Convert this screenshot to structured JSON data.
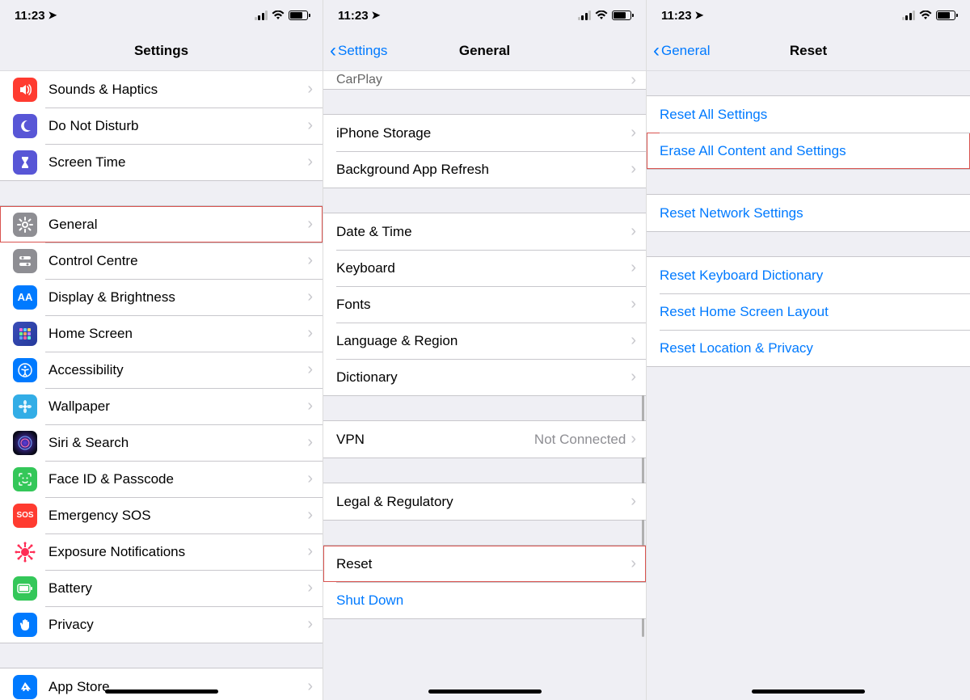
{
  "status": {
    "time": "11:23"
  },
  "screen1": {
    "title": "Settings",
    "groups": [
      [
        {
          "id": "sounds",
          "label": "Sounds & Haptics",
          "icon": "sounds-icon",
          "bg": "bg-red"
        },
        {
          "id": "dnd",
          "label": "Do Not Disturb",
          "icon": "moon-icon",
          "bg": "bg-purple"
        },
        {
          "id": "screentime",
          "label": "Screen Time",
          "icon": "hourglass-icon",
          "bg": "bg-purple"
        }
      ],
      [
        {
          "id": "general",
          "label": "General",
          "icon": "gear-icon",
          "bg": "bg-grey",
          "highlight": true
        },
        {
          "id": "control",
          "label": "Control Centre",
          "icon": "switches-icon",
          "bg": "bg-grey"
        },
        {
          "id": "display",
          "label": "Display & Brightness",
          "icon": "aa-icon",
          "bg": "bg-blue"
        },
        {
          "id": "home",
          "label": "Home Screen",
          "icon": "grid-icon",
          "bg": "bg-darkblue"
        },
        {
          "id": "access",
          "label": "Accessibility",
          "icon": "person-icon",
          "bg": "bg-blue"
        },
        {
          "id": "wallpaper",
          "label": "Wallpaper",
          "icon": "flower-icon",
          "bg": "bg-teal"
        },
        {
          "id": "siri",
          "label": "Siri & Search",
          "icon": "siri-icon",
          "bg": "bg-black"
        },
        {
          "id": "faceid",
          "label": "Face ID & Passcode",
          "icon": "face-icon",
          "bg": "bg-green"
        },
        {
          "id": "sos",
          "label": "Emergency SOS",
          "icon": "sos-icon",
          "bg": "bg-red"
        },
        {
          "id": "exposure",
          "label": "Exposure Notifications",
          "icon": "virus-icon",
          "bg": "bg-red-dot"
        },
        {
          "id": "battery",
          "label": "Battery",
          "icon": "battery-icon",
          "bg": "bg-green"
        },
        {
          "id": "privacy",
          "label": "Privacy",
          "icon": "hand-icon",
          "bg": "bg-blue"
        }
      ],
      [
        {
          "id": "appstore",
          "label": "App Store",
          "icon": "appstore-icon",
          "bg": "bg-blue"
        }
      ]
    ]
  },
  "screen2": {
    "back": "Settings",
    "title": "General",
    "groups": [
      [
        {
          "id": "carplay",
          "label": "CarPlay"
        }
      ],
      [
        {
          "id": "storage",
          "label": "iPhone Storage"
        },
        {
          "id": "bgapp",
          "label": "Background App Refresh"
        }
      ],
      [
        {
          "id": "datetime",
          "label": "Date & Time"
        },
        {
          "id": "keyboard",
          "label": "Keyboard"
        },
        {
          "id": "fonts",
          "label": "Fonts"
        },
        {
          "id": "lang",
          "label": "Language & Region"
        },
        {
          "id": "dict",
          "label": "Dictionary"
        }
      ],
      [
        {
          "id": "vpn",
          "label": "VPN",
          "detail": "Not Connected"
        }
      ],
      [
        {
          "id": "legal",
          "label": "Legal & Regulatory"
        }
      ],
      [
        {
          "id": "reset",
          "label": "Reset",
          "highlight": true
        },
        {
          "id": "shutdown",
          "label": "Shut Down",
          "link": true
        }
      ]
    ]
  },
  "screen3": {
    "back": "General",
    "title": "Reset",
    "groups": [
      [
        {
          "id": "reset-all",
          "label": "Reset All Settings",
          "link": true
        },
        {
          "id": "erase-all",
          "label": "Erase All Content and Settings",
          "link": true,
          "highlight": true
        }
      ],
      [
        {
          "id": "reset-net",
          "label": "Reset Network Settings",
          "link": true
        }
      ],
      [
        {
          "id": "reset-kbd",
          "label": "Reset Keyboard Dictionary",
          "link": true
        },
        {
          "id": "reset-home",
          "label": "Reset Home Screen Layout",
          "link": true
        },
        {
          "id": "reset-loc",
          "label": "Reset Location & Privacy",
          "link": true
        }
      ]
    ]
  }
}
